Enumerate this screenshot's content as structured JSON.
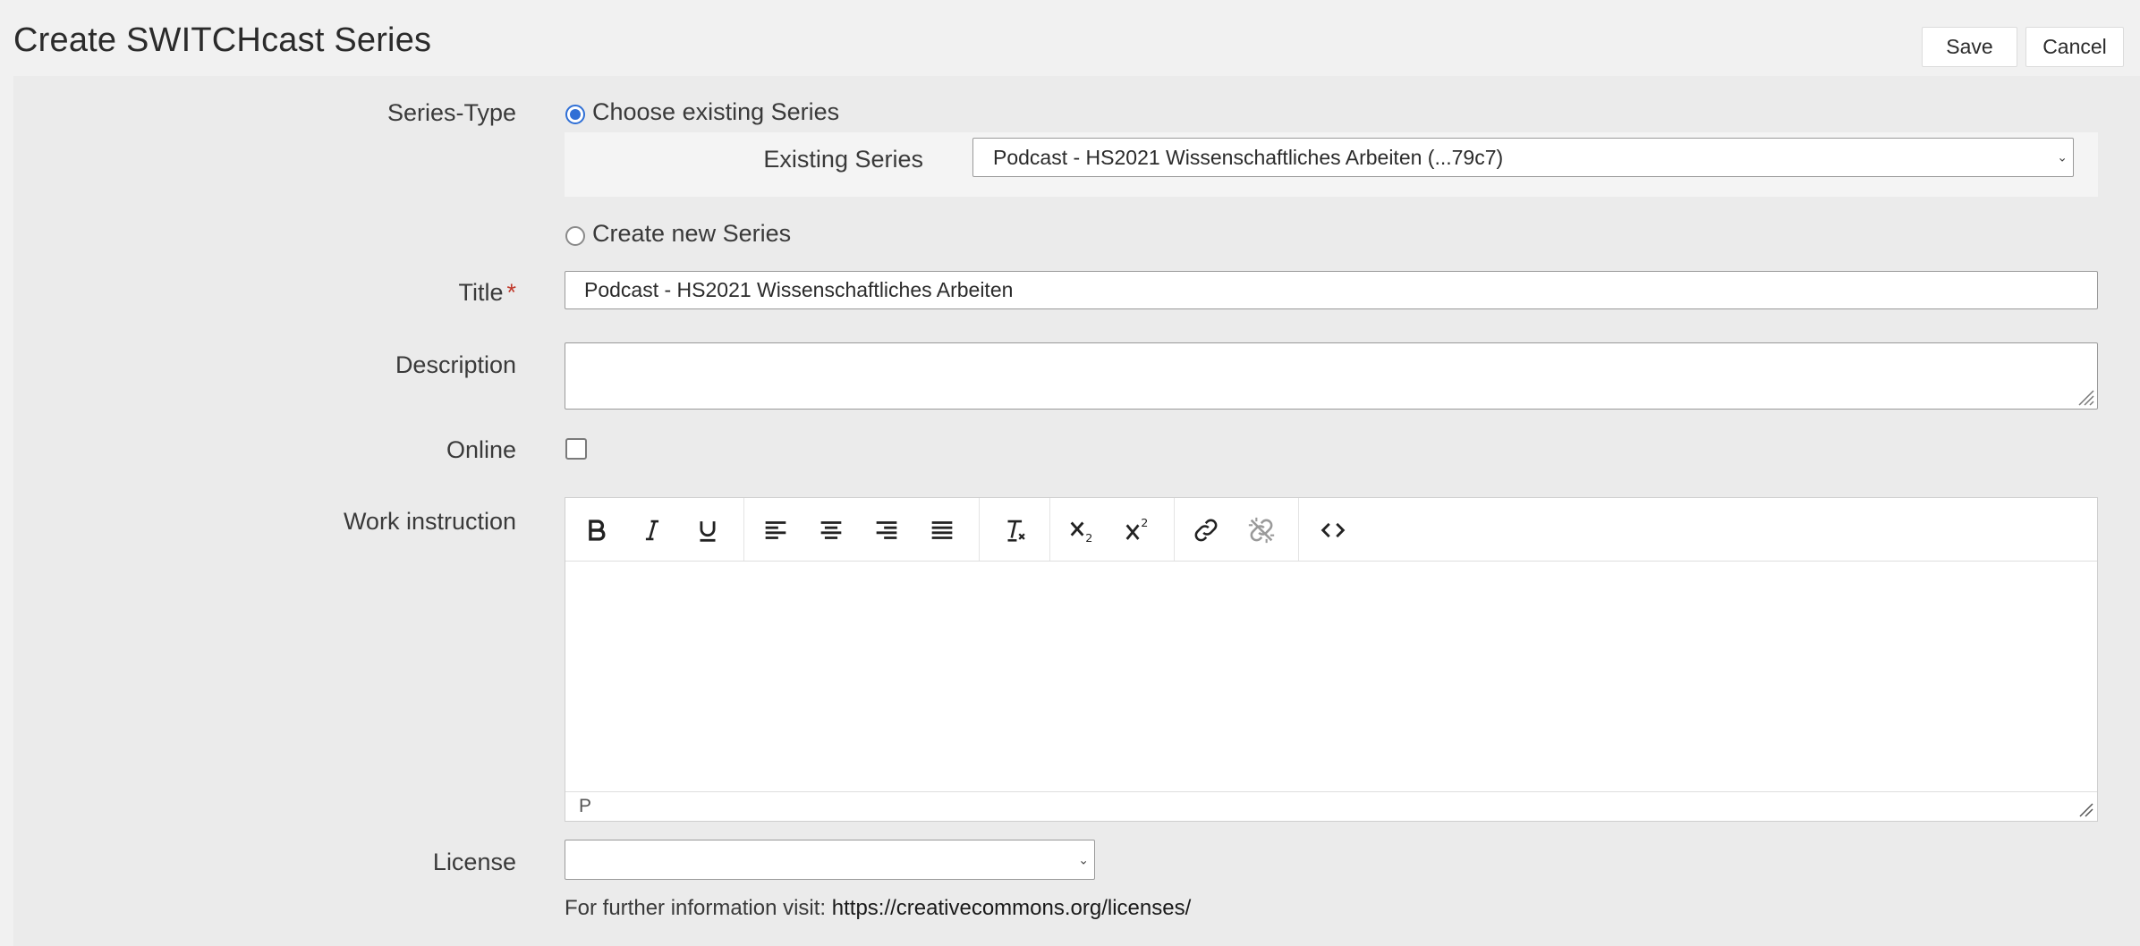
{
  "header": {
    "title": "Create SWITCHcast Series",
    "save_label": "Save",
    "cancel_label": "Cancel"
  },
  "form": {
    "series_type": {
      "label": "Series-Type",
      "option_existing": "Choose existing Series",
      "option_new": "Create new Series",
      "selected": "existing"
    },
    "existing_series": {
      "label": "Existing Series",
      "value": "Podcast - HS2021 Wissenschaftliches Arbeiten (...79c7)"
    },
    "title": {
      "label": "Title",
      "required_mark": "*",
      "value": "Podcast - HS2021 Wissenschaftliches Arbeiten"
    },
    "description": {
      "label": "Description",
      "value": ""
    },
    "online": {
      "label": "Online",
      "checked": false
    },
    "work_instruction": {
      "label": "Work instruction",
      "toolbar": [
        "bold-icon",
        "italic-icon",
        "underline-icon",
        "align-left-icon",
        "align-center-icon",
        "align-right-icon",
        "align-justify-icon",
        "clear-format-icon",
        "subscript-icon",
        "superscript-icon",
        "link-icon",
        "unlink-icon",
        "source-code-icon"
      ],
      "status_path": "P"
    },
    "license": {
      "label": "License",
      "value": "",
      "info_prefix": "For further information visit:",
      "info_link": "https://creativecommons.org/licenses/"
    }
  },
  "colors": {
    "accent": "#2f6fd6",
    "required": "#c0392b",
    "panel_bg": "#ebebeb",
    "page_bg": "#f1f1f1"
  }
}
